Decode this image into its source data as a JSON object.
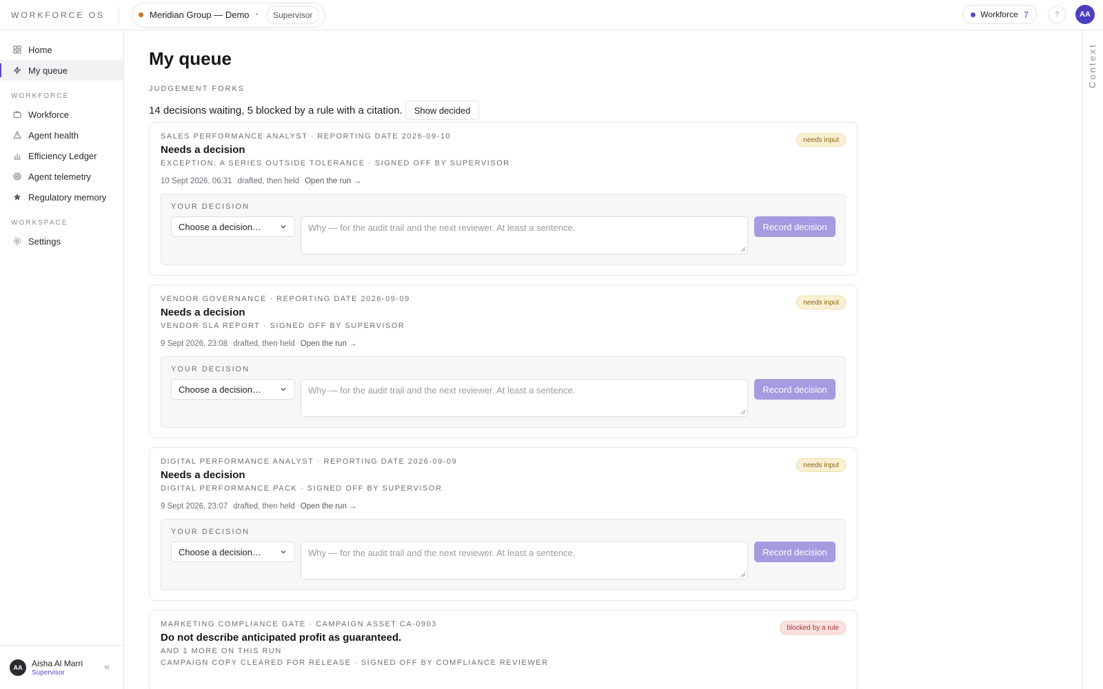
{
  "topbar": {
    "brand": "WORKFORCE OS",
    "org_name": "Meridian Group — Demo",
    "org_bullet": "•",
    "role": "Supervisor",
    "workforce_label": "Workforce",
    "workforce_count": "7",
    "help_glyph": "?",
    "avatar_initials": "AA"
  },
  "sidebar": {
    "items_top": [
      {
        "label": "Home",
        "icon": "grid-icon"
      },
      {
        "label": "My queue",
        "icon": "bolt-icon",
        "active": true
      }
    ],
    "section_workforce": "WORKFORCE",
    "items_workforce": [
      {
        "label": "Workforce",
        "icon": "briefcase-icon"
      },
      {
        "label": "Agent health",
        "icon": "warning-triangle-icon"
      },
      {
        "label": "Efficiency Ledger",
        "icon": "bar-chart-icon"
      },
      {
        "label": "Agent telemetry",
        "icon": "radar-icon"
      },
      {
        "label": "Regulatory memory",
        "icon": "star-icon"
      }
    ],
    "section_workspace": "WORKSPACE",
    "items_workspace": [
      {
        "label": "Settings",
        "icon": "gear-icon"
      }
    ],
    "user": {
      "initials": "AA",
      "name": "Aisha Al Marri",
      "role": "Supervisor"
    },
    "collapse_glyph": "«"
  },
  "context_rail": {
    "label": "Context"
  },
  "main": {
    "title": "My queue",
    "eyebrow": "JUDGEMENT FORKS",
    "summary": "14 decisions waiting, 5 blocked by a rule with a citation.",
    "show_decided": "Show decided",
    "cards": [
      {
        "eyebrow": "SALES PERFORMANCE ANALYST · REPORTING DATE 2026-09-10",
        "title": "Needs a decision",
        "sub": "EXCEPTION: A SERIES OUTSIDE TOLERANCE · SIGNED OFF BY SUPERVISOR",
        "timestamp": "10 Sept 2026, 06:31",
        "state": "drafted, then held",
        "open_run": "Open the run →",
        "badge": "needs input",
        "decision_label": "YOUR DECISION",
        "select_value": "Choose a decision…",
        "why_placeholder": "Why — for the audit trail and the next reviewer. At least a sentence.",
        "record_label": "Record decision"
      },
      {
        "eyebrow": "VENDOR GOVERNANCE · REPORTING DATE 2026-09-09",
        "title": "Needs a decision",
        "sub": "VENDOR SLA REPORT · SIGNED OFF BY SUPERVISOR",
        "timestamp": "9 Sept 2026, 23:08",
        "state": "drafted, then held",
        "open_run": "Open the run →",
        "badge": "needs input",
        "decision_label": "YOUR DECISION",
        "select_value": "Choose a decision…",
        "why_placeholder": "Why — for the audit trail and the next reviewer. At least a sentence.",
        "record_label": "Record decision"
      },
      {
        "eyebrow": "DIGITAL PERFORMANCE ANALYST · REPORTING DATE 2026-09-09",
        "title": "Needs a decision",
        "sub": "DIGITAL PERFORMANCE PACK · SIGNED OFF BY SUPERVISOR",
        "timestamp": "9 Sept 2026, 23:07",
        "state": "drafted, then held",
        "open_run": "Open the run →",
        "badge": "needs input",
        "decision_label": "YOUR DECISION",
        "select_value": "Choose a decision…",
        "why_placeholder": "Why — for the audit trail and the next reviewer. At least a sentence.",
        "record_label": "Record decision"
      }
    ],
    "blocked_card": {
      "eyebrow": "MARKETING COMPLIANCE GATE · CAMPAIGN ASSET CA-0903",
      "title": "Do not describe anticipated profit as guaranteed.",
      "more": "AND 1 MORE ON THIS RUN",
      "sub": "CAMPAIGN COPY CLEARED FOR RELEASE · SIGNED OFF BY COMPLIANCE REVIEWER",
      "badge": "blocked by a rule"
    }
  },
  "colors": {
    "accent": "#5a46c8",
    "record_button": "#a59be0",
    "badge_warn_bg": "#fbf0d3",
    "badge_block_bg": "#fbe1e1",
    "org_dot": "#c7781a"
  }
}
